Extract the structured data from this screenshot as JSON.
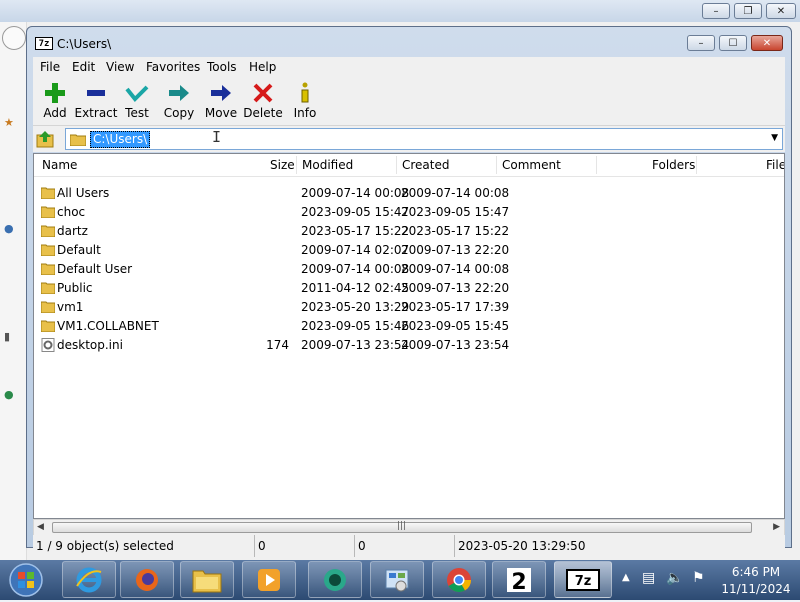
{
  "window": {
    "title": "C:\\Users\\"
  },
  "menu": [
    "File",
    "Edit",
    "View",
    "Favorites",
    "Tools",
    "Help"
  ],
  "toolbar": [
    {
      "label": "Add",
      "icon": "plus-icon"
    },
    {
      "label": "Extract",
      "icon": "minus-icon"
    },
    {
      "label": "Test",
      "icon": "check-icon"
    },
    {
      "label": "Copy",
      "icon": "copy-arrow-icon"
    },
    {
      "label": "Move",
      "icon": "move-arrow-icon"
    },
    {
      "label": "Delete",
      "icon": "delete-x-icon"
    },
    {
      "label": "Info",
      "icon": "info-icon"
    }
  ],
  "address": {
    "value": "C:\\Users\\"
  },
  "columns": [
    "Name",
    "Size",
    "Modified",
    "Created",
    "Comment",
    "Folders",
    "File"
  ],
  "files": [
    {
      "name": "All Users",
      "size": "",
      "modified": "2009-07-14 00:08",
      "created": "2009-07-14 00:08",
      "type": "folder"
    },
    {
      "name": "choc",
      "size": "",
      "modified": "2023-09-05 15:47",
      "created": "2023-09-05 15:47",
      "type": "folder"
    },
    {
      "name": "dartz",
      "size": "",
      "modified": "2023-05-17 15:22",
      "created": "2023-05-17 15:22",
      "type": "folder"
    },
    {
      "name": "Default",
      "size": "",
      "modified": "2009-07-14 02:07",
      "created": "2009-07-13 22:20",
      "type": "folder"
    },
    {
      "name": "Default User",
      "size": "",
      "modified": "2009-07-14 00:08",
      "created": "2009-07-14 00:08",
      "type": "folder"
    },
    {
      "name": "Public",
      "size": "",
      "modified": "2011-04-12 02:45",
      "created": "2009-07-13 22:20",
      "type": "folder"
    },
    {
      "name": "vm1",
      "size": "",
      "modified": "2023-05-20 13:29",
      "created": "2023-05-17 17:39",
      "type": "folder"
    },
    {
      "name": "VM1.COLLABNET",
      "size": "",
      "modified": "2023-09-05 15:46",
      "created": "2023-09-05 15:45",
      "type": "folder"
    },
    {
      "name": "desktop.ini",
      "size": "174",
      "modified": "2009-07-13 23:54",
      "created": "2009-07-13 23:54",
      "type": "file"
    }
  ],
  "status": {
    "selection": "1 / 9 object(s) selected",
    "size": "0",
    "packed": "0",
    "modified": "2023-05-20 13:29:50"
  },
  "taskbar": {
    "apps": [
      "ie-icon",
      "firefox-icon",
      "explorer-icon",
      "media-player-icon",
      "app-bubble-icon",
      "control-panel-icon",
      "chrome-icon",
      "app-2-icon",
      "7zip-icon"
    ],
    "time": "6:46 PM",
    "date": "11/11/2024"
  },
  "colors": {
    "accent": "#3399ff",
    "taskbar": "#2c4a72",
    "add": "#1a9a1a",
    "delete": "#d61a1a"
  }
}
